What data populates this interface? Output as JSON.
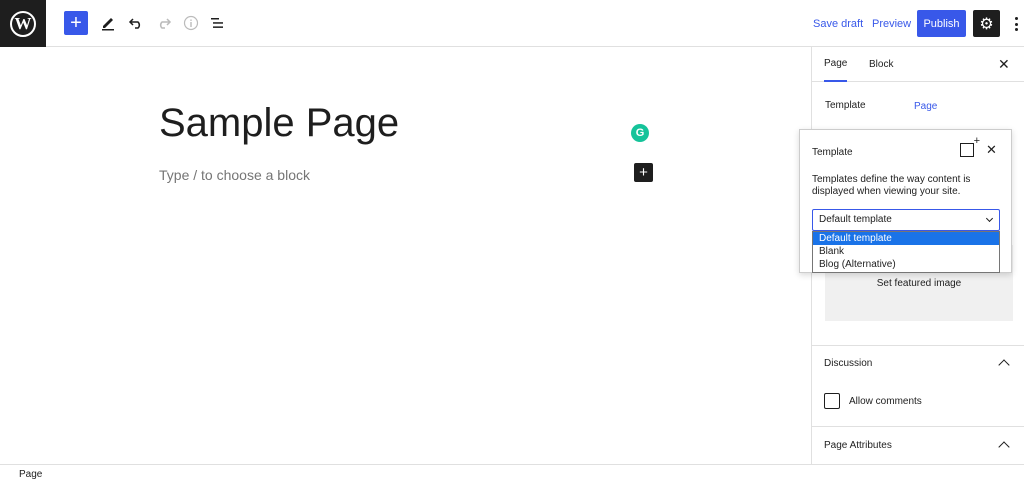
{
  "toolbar": {
    "logo": "W",
    "add_label": "+",
    "save_draft": "Save draft",
    "preview": "Preview",
    "publish": "Publish",
    "icons": [
      "plus-icon",
      "pencil-icon",
      "undo-icon",
      "redo-icon",
      "info-icon",
      "list-view-icon",
      "gear-icon",
      "more-vertical-icon"
    ]
  },
  "editor": {
    "title": "Sample Page",
    "placeholder": "Type / to choose a block",
    "grammarly": "G",
    "inline_add": "+"
  },
  "sidebar": {
    "tabs": [
      "Page",
      "Block"
    ],
    "template_label": "Template",
    "template_value": "Page",
    "featured_image": "Set featured image",
    "discussion_title": "Discussion",
    "allow_comments": "Allow comments",
    "page_attributes": "Page Attributes"
  },
  "popover": {
    "title": "Template",
    "description": "Templates define the way content is displayed when viewing your site.",
    "selected": "Default template",
    "options": [
      "Default template",
      "Blank",
      "Blog (Alternative)"
    ]
  },
  "status": {
    "breadcrumb": "Page"
  },
  "colors": {
    "accent": "#3858e9",
    "dark": "#1e1e1e",
    "grammarly": "#15c39a"
  }
}
